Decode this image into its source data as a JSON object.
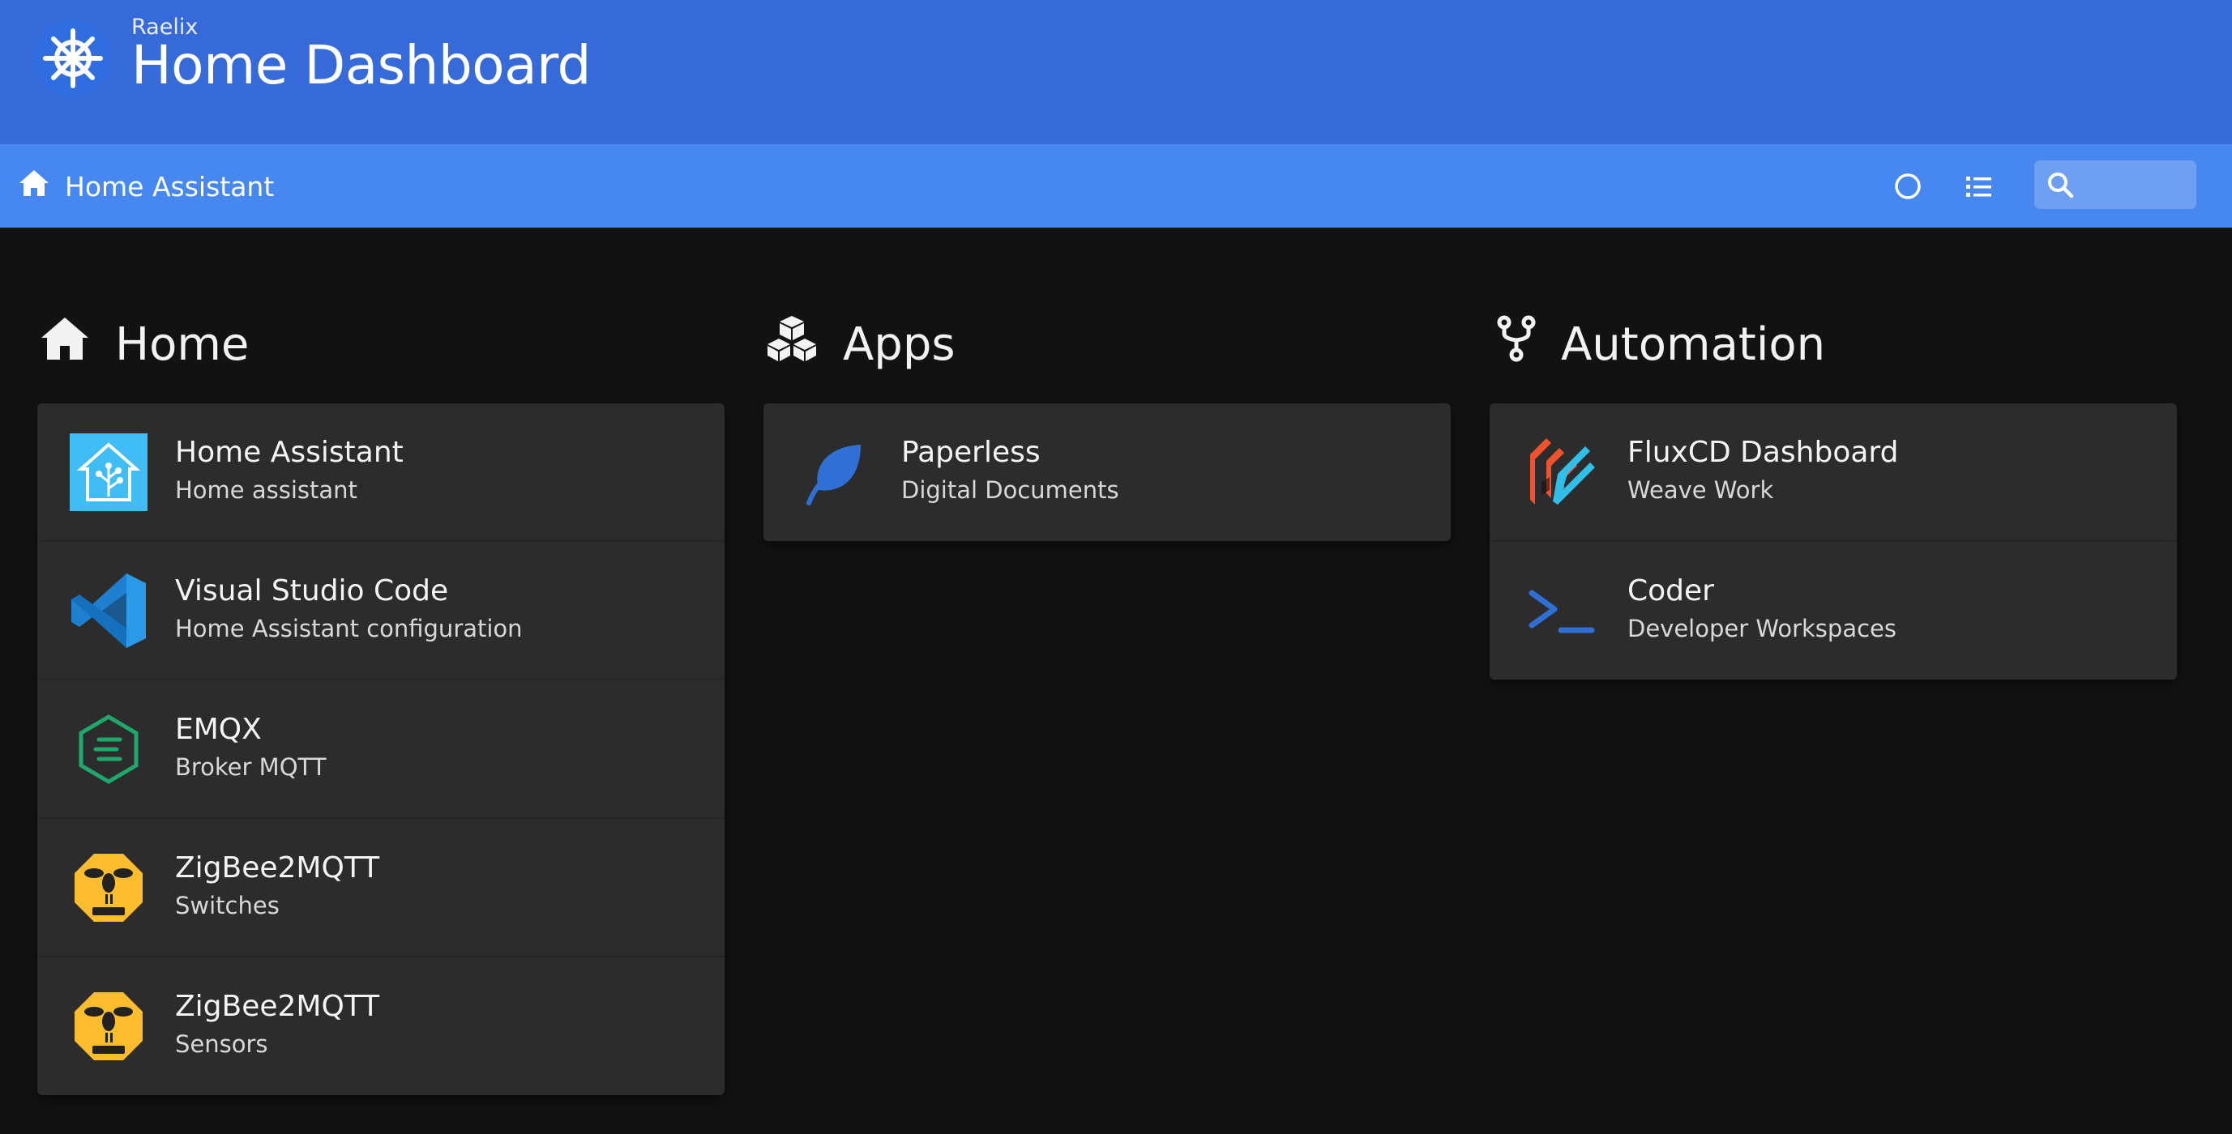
{
  "header": {
    "subtitle": "Raelix",
    "title": "Home Dashboard",
    "logo_icon": "kubernetes-helm-icon"
  },
  "navbar": {
    "home_label": "Home Assistant",
    "search_placeholder": ""
  },
  "colors": {
    "topbar": "#366ad8",
    "navbar": "#4688f0",
    "background": "#121212",
    "card": "#2c2c2c"
  },
  "sections": [
    {
      "title": "Home",
      "icon": "house-icon",
      "items": [
        {
          "title": "Home Assistant",
          "subtitle": "Home assistant",
          "icon": "home-assistant-icon"
        },
        {
          "title": "Visual Studio Code",
          "subtitle": "Home Assistant configuration",
          "icon": "vscode-icon"
        },
        {
          "title": "EMQX",
          "subtitle": "Broker MQTT",
          "icon": "emqx-icon"
        },
        {
          "title": "ZigBee2MQTT",
          "subtitle": "Switches",
          "icon": "zigbee2mqtt-icon"
        },
        {
          "title": "ZigBee2MQTT",
          "subtitle": "Sensors",
          "icon": "zigbee2mqtt-icon"
        }
      ]
    },
    {
      "title": "Apps",
      "icon": "cubes-icon",
      "items": [
        {
          "title": "Paperless",
          "subtitle": "Digital Documents",
          "icon": "leaf-icon"
        }
      ]
    },
    {
      "title": "Automation",
      "icon": "code-fork-icon",
      "items": [
        {
          "title": "FluxCD Dashboard",
          "subtitle": "Weave Work",
          "icon": "fluxcd-icon"
        },
        {
          "title": "Coder",
          "subtitle": "Developer Workspaces",
          "icon": "terminal-icon"
        }
      ]
    }
  ]
}
